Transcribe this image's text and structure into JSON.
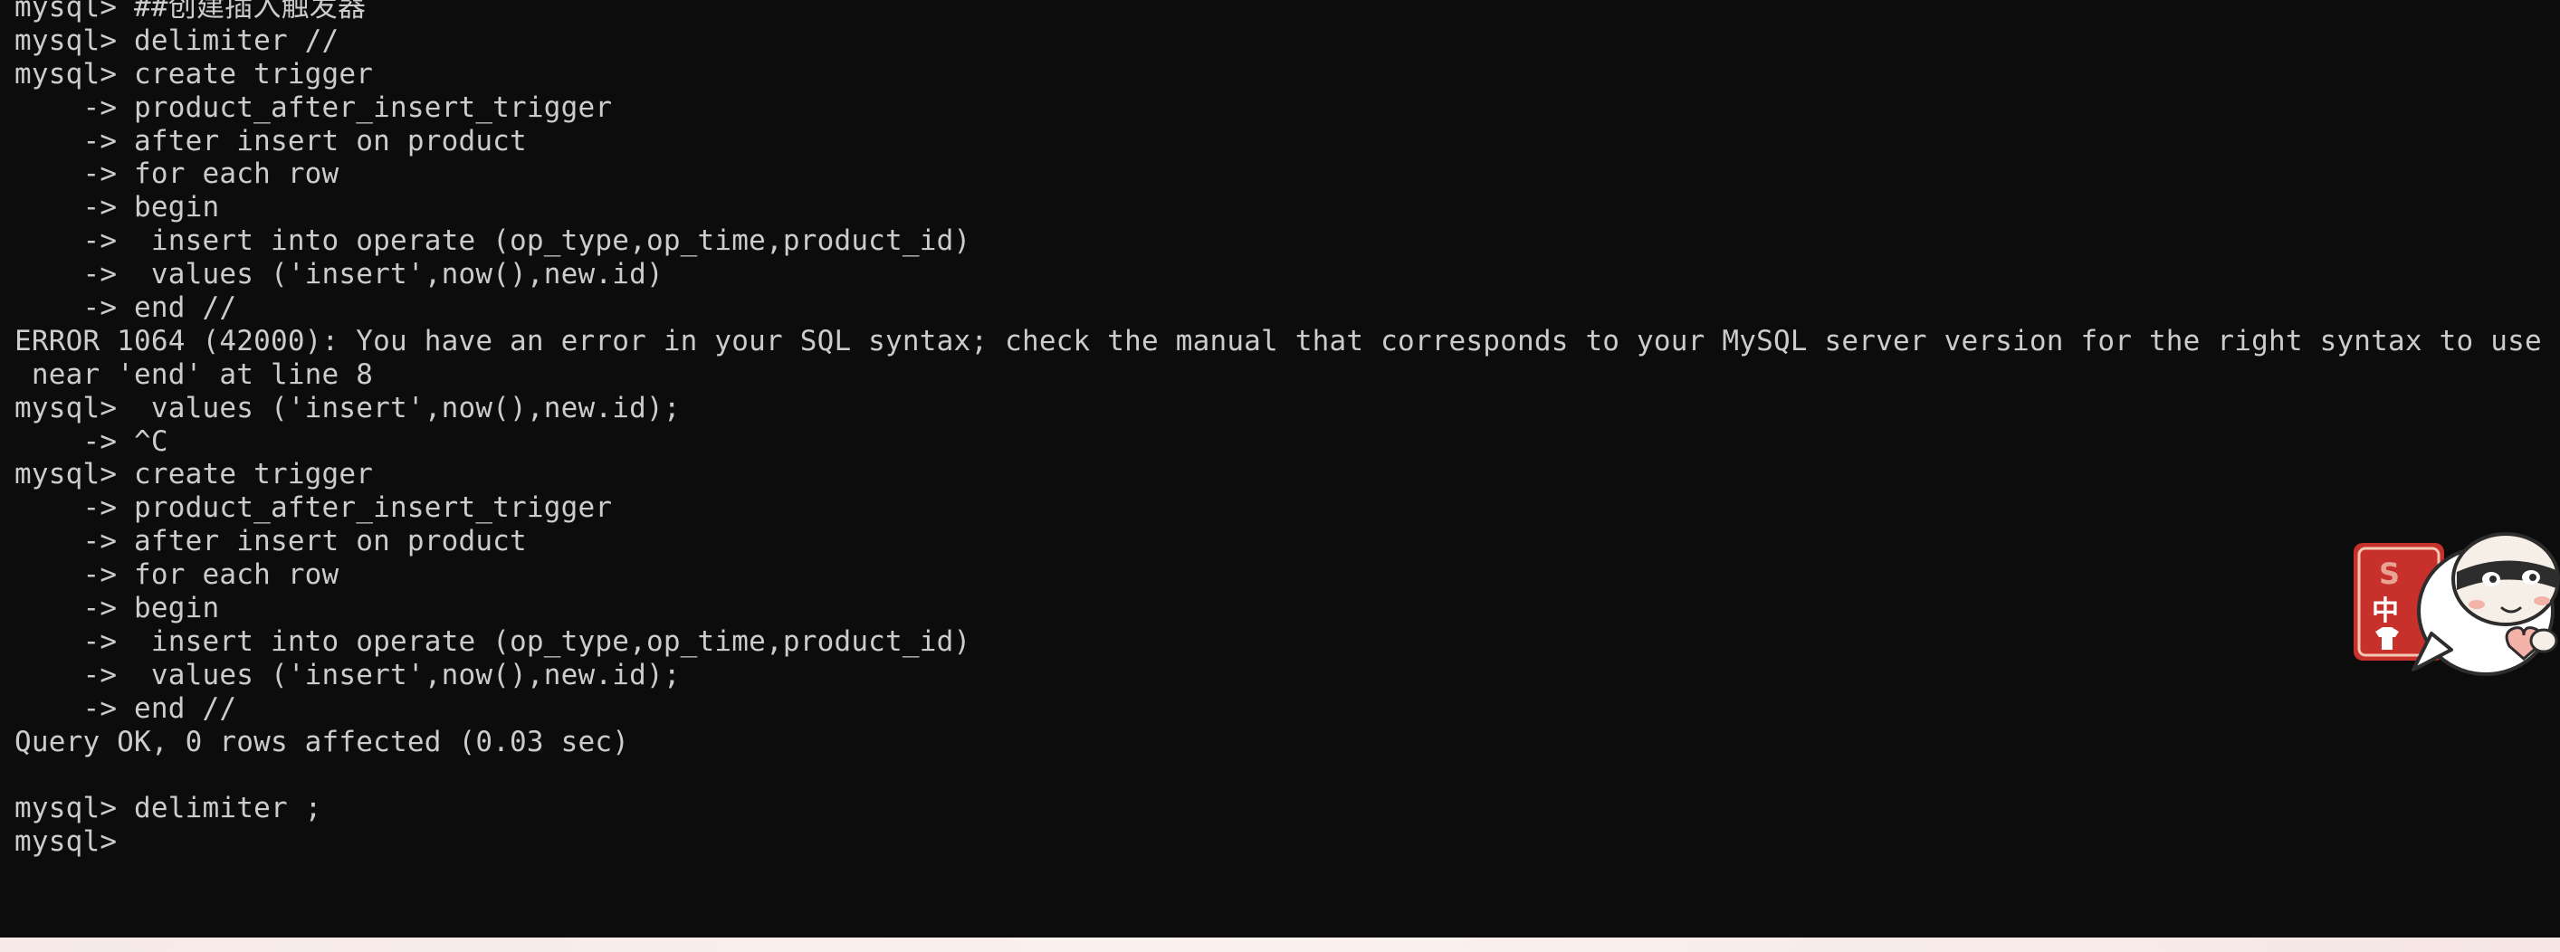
{
  "terminal": {
    "lines": [
      "mysql> ##创建插入触发器",
      "mysql> delimiter //",
      "mysql> create trigger",
      "    -> product_after_insert_trigger",
      "    -> after insert on product",
      "    -> for each row",
      "    -> begin",
      "    ->  insert into operate (op_type,op_time,product_id)",
      "    ->  values ('insert',now(),new.id)",
      "    -> end //",
      "ERROR 1064 (42000): You have an error in your SQL syntax; check the manual that corresponds to your MySQL server version for the right syntax to use",
      " near 'end' at line 8",
      "mysql>  values ('insert',now(),new.id);",
      "    -> ^C",
      "mysql> create trigger",
      "    -> product_after_insert_trigger",
      "    -> after insert on product",
      "    -> for each row",
      "    -> begin",
      "    ->  insert into operate (op_type,op_time,product_id)",
      "    ->  values ('insert',now(),new.id);",
      "    -> end //",
      "Query OK, 0 rows affected (0.03 sec)",
      "",
      "mysql> delimiter ;",
      "mysql>"
    ]
  },
  "sticker": {
    "badge_letter": "S",
    "badge_char": "中",
    "badge_icon": "shirt-icon",
    "accent": "#c8302c"
  },
  "colors": {
    "background": "#0c0c0c",
    "text": "#cccccc"
  }
}
